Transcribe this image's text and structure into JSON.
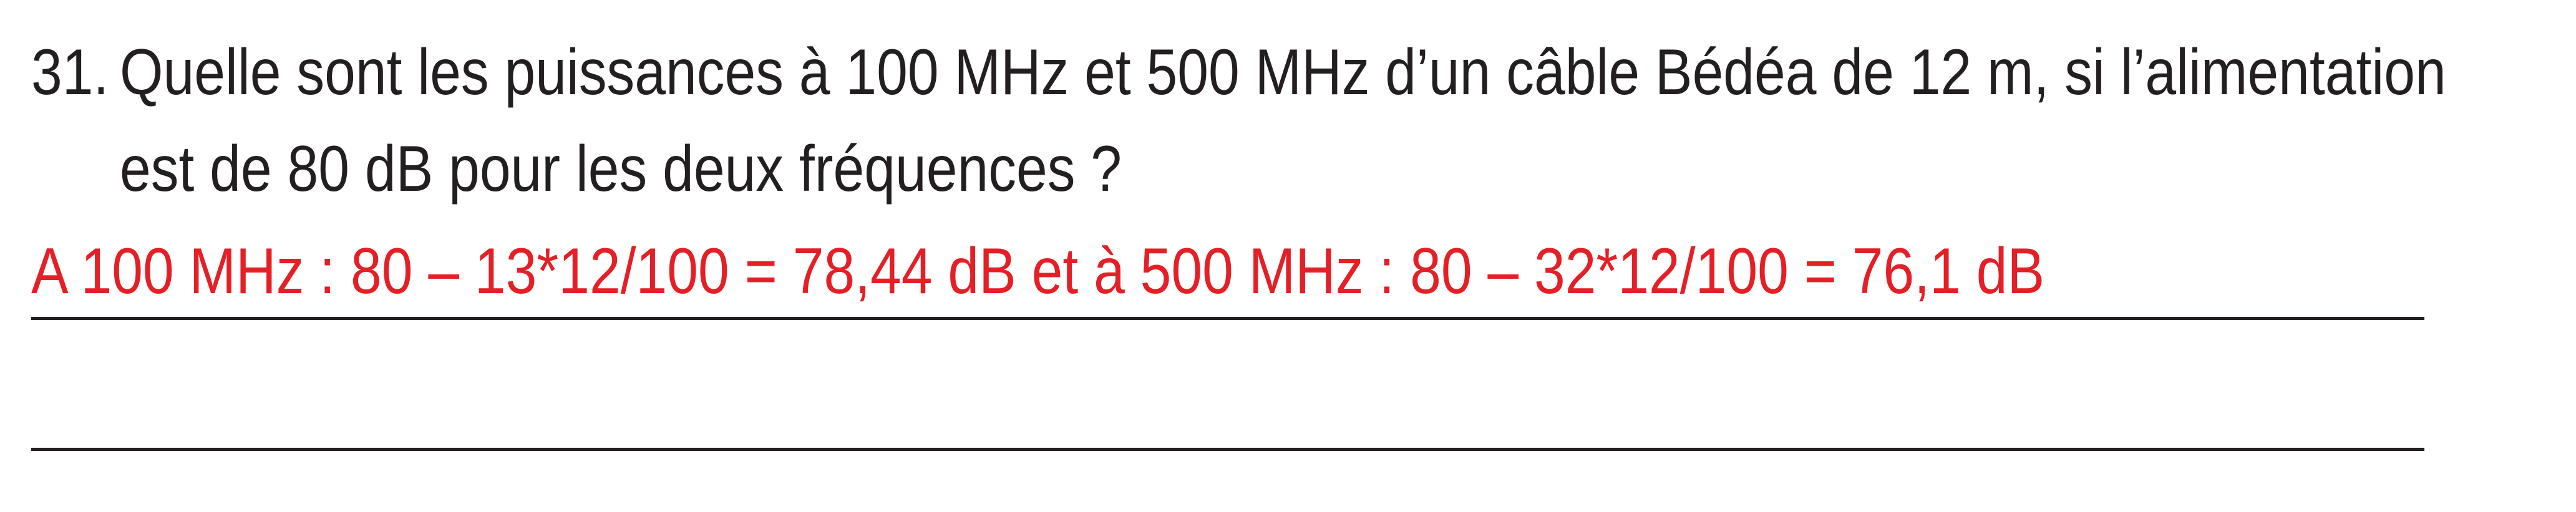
{
  "question": {
    "number": "31.",
    "line1": "Quelle sont les puissances à 100 MHz et 500 MHz d’un câble Bédéa de 12 m, si l’alimentation",
    "line2": "est de 80 dB pour les deux fréquences ?"
  },
  "answer": {
    "text": "A 100 MHz : 80 – 13*12/100 = 78,44 dB et à 500 MHz : 80 – 32*12/100 = 76,1 dB",
    "color": "#e41f26"
  },
  "colors": {
    "text": "#231f20",
    "rule": "#231f20"
  }
}
